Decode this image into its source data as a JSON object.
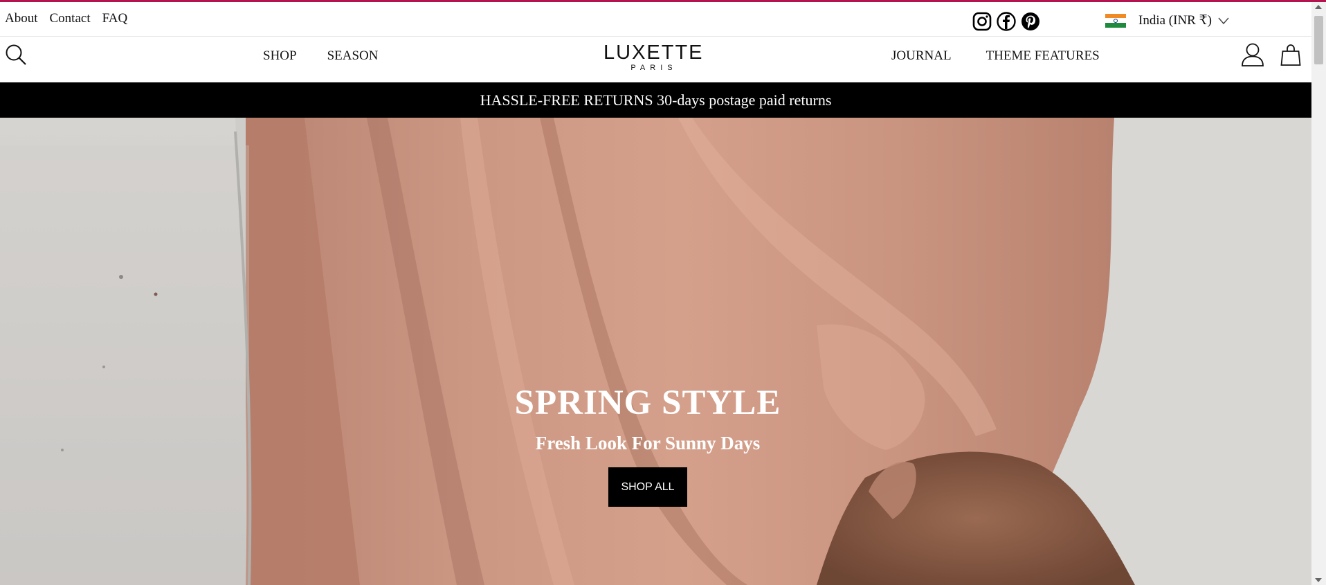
{
  "theme": {
    "accent": "#b5134f",
    "announcement_bg": "#000000",
    "text": "#111111"
  },
  "utility_nav": {
    "links": [
      "About",
      "Contact",
      "FAQ"
    ],
    "social": [
      "instagram-icon",
      "facebook-icon",
      "pinterest-icon"
    ],
    "locale": {
      "label": "India (INR ₹)",
      "flag": "india-flag-icon"
    }
  },
  "header": {
    "logo": {
      "name": "LUXETTE",
      "tagline": "PARIS"
    },
    "nav_left": [
      "SHOP",
      "SEASON"
    ],
    "nav_right": [
      "JOURNAL",
      "THEME FEATURES"
    ],
    "icons": [
      "search-icon",
      "user-icon",
      "bag-icon"
    ]
  },
  "announcement": {
    "text": "HASSLE-FREE RETURNS 30-days postage paid returns"
  },
  "hero": {
    "title": "SPRING STYLE",
    "subtitle": "Fresh Look For Sunny Days",
    "cta": "SHOP ALL"
  }
}
